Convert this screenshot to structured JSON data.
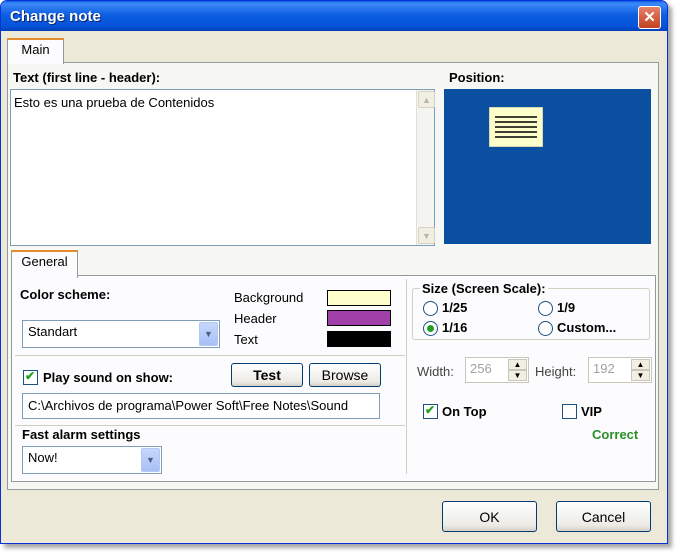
{
  "window": {
    "title": "Change note",
    "close_icon": "close-icon"
  },
  "tabs": {
    "main": "Main",
    "general": "General"
  },
  "text_section": {
    "label": "Text (first line - header):",
    "content": "Esto es una prueba de Contenidos"
  },
  "position": {
    "label": "Position:",
    "preview_color": "#0b4fa0"
  },
  "color_scheme": {
    "label": "Color scheme:",
    "selected": "Standart",
    "background_label": "Background",
    "header_label": "Header",
    "text_label": "Text",
    "background_color": "#ffffcc",
    "header_color": "#a040a8",
    "text_color": "#000000"
  },
  "size": {
    "label": "Size (Screen Scale):",
    "options": [
      "1/25",
      "1/9",
      "1/16",
      "Custom..."
    ],
    "selected": "1/16"
  },
  "sound": {
    "label": "Play sound on show:",
    "checked": true,
    "test_label": "Test",
    "browse_label": "Browse",
    "path": "C:\\Archivos de programa\\Power Soft\\Free Notes\\Sound"
  },
  "dimensions": {
    "width_label": "Width:",
    "width_value": "256",
    "height_label": "Height:",
    "height_value": "192"
  },
  "flags": {
    "on_top_label": "On Top",
    "on_top_checked": true,
    "vip_label": "VIP",
    "vip_checked": false
  },
  "alarm": {
    "label": "Fast alarm settings",
    "selected": "Now!",
    "status": "Correct"
  },
  "footer": {
    "ok_label": "OK",
    "cancel_label": "Cancel"
  }
}
